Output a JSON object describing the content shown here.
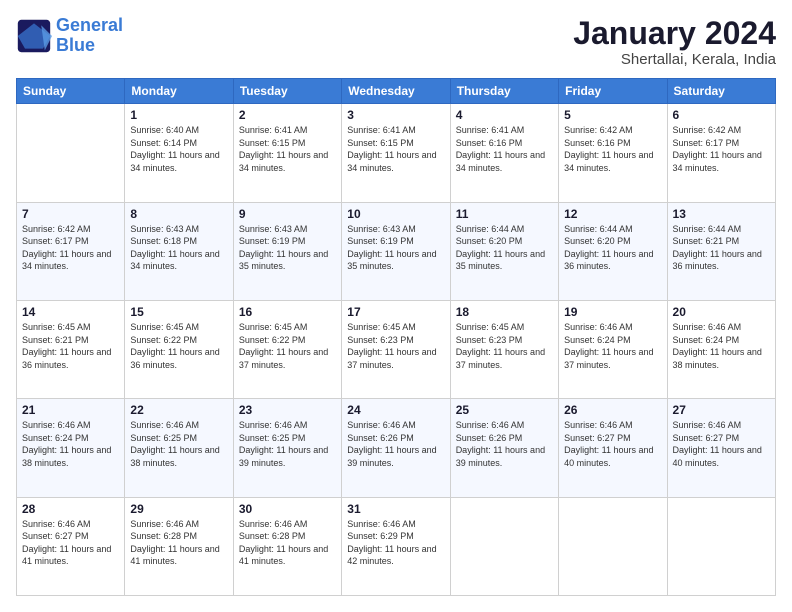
{
  "logo": {
    "line1": "General",
    "line2": "Blue"
  },
  "header": {
    "title": "January 2024",
    "subtitle": "Shertallai, Kerala, India"
  },
  "columns": [
    "Sunday",
    "Monday",
    "Tuesday",
    "Wednesday",
    "Thursday",
    "Friday",
    "Saturday"
  ],
  "weeks": [
    [
      {
        "day": "",
        "sunrise": "",
        "sunset": "",
        "daylight": ""
      },
      {
        "day": "1",
        "sunrise": "Sunrise: 6:40 AM",
        "sunset": "Sunset: 6:14 PM",
        "daylight": "Daylight: 11 hours and 34 minutes."
      },
      {
        "day": "2",
        "sunrise": "Sunrise: 6:41 AM",
        "sunset": "Sunset: 6:15 PM",
        "daylight": "Daylight: 11 hours and 34 minutes."
      },
      {
        "day": "3",
        "sunrise": "Sunrise: 6:41 AM",
        "sunset": "Sunset: 6:15 PM",
        "daylight": "Daylight: 11 hours and 34 minutes."
      },
      {
        "day": "4",
        "sunrise": "Sunrise: 6:41 AM",
        "sunset": "Sunset: 6:16 PM",
        "daylight": "Daylight: 11 hours and 34 minutes."
      },
      {
        "day": "5",
        "sunrise": "Sunrise: 6:42 AM",
        "sunset": "Sunset: 6:16 PM",
        "daylight": "Daylight: 11 hours and 34 minutes."
      },
      {
        "day": "6",
        "sunrise": "Sunrise: 6:42 AM",
        "sunset": "Sunset: 6:17 PM",
        "daylight": "Daylight: 11 hours and 34 minutes."
      }
    ],
    [
      {
        "day": "7",
        "sunrise": "Sunrise: 6:42 AM",
        "sunset": "Sunset: 6:17 PM",
        "daylight": "Daylight: 11 hours and 34 minutes."
      },
      {
        "day": "8",
        "sunrise": "Sunrise: 6:43 AM",
        "sunset": "Sunset: 6:18 PM",
        "daylight": "Daylight: 11 hours and 34 minutes."
      },
      {
        "day": "9",
        "sunrise": "Sunrise: 6:43 AM",
        "sunset": "Sunset: 6:19 PM",
        "daylight": "Daylight: 11 hours and 35 minutes."
      },
      {
        "day": "10",
        "sunrise": "Sunrise: 6:43 AM",
        "sunset": "Sunset: 6:19 PM",
        "daylight": "Daylight: 11 hours and 35 minutes."
      },
      {
        "day": "11",
        "sunrise": "Sunrise: 6:44 AM",
        "sunset": "Sunset: 6:20 PM",
        "daylight": "Daylight: 11 hours and 35 minutes."
      },
      {
        "day": "12",
        "sunrise": "Sunrise: 6:44 AM",
        "sunset": "Sunset: 6:20 PM",
        "daylight": "Daylight: 11 hours and 36 minutes."
      },
      {
        "day": "13",
        "sunrise": "Sunrise: 6:44 AM",
        "sunset": "Sunset: 6:21 PM",
        "daylight": "Daylight: 11 hours and 36 minutes."
      }
    ],
    [
      {
        "day": "14",
        "sunrise": "Sunrise: 6:45 AM",
        "sunset": "Sunset: 6:21 PM",
        "daylight": "Daylight: 11 hours and 36 minutes."
      },
      {
        "day": "15",
        "sunrise": "Sunrise: 6:45 AM",
        "sunset": "Sunset: 6:22 PM",
        "daylight": "Daylight: 11 hours and 36 minutes."
      },
      {
        "day": "16",
        "sunrise": "Sunrise: 6:45 AM",
        "sunset": "Sunset: 6:22 PM",
        "daylight": "Daylight: 11 hours and 37 minutes."
      },
      {
        "day": "17",
        "sunrise": "Sunrise: 6:45 AM",
        "sunset": "Sunset: 6:23 PM",
        "daylight": "Daylight: 11 hours and 37 minutes."
      },
      {
        "day": "18",
        "sunrise": "Sunrise: 6:45 AM",
        "sunset": "Sunset: 6:23 PM",
        "daylight": "Daylight: 11 hours and 37 minutes."
      },
      {
        "day": "19",
        "sunrise": "Sunrise: 6:46 AM",
        "sunset": "Sunset: 6:24 PM",
        "daylight": "Daylight: 11 hours and 37 minutes."
      },
      {
        "day": "20",
        "sunrise": "Sunrise: 6:46 AM",
        "sunset": "Sunset: 6:24 PM",
        "daylight": "Daylight: 11 hours and 38 minutes."
      }
    ],
    [
      {
        "day": "21",
        "sunrise": "Sunrise: 6:46 AM",
        "sunset": "Sunset: 6:24 PM",
        "daylight": "Daylight: 11 hours and 38 minutes."
      },
      {
        "day": "22",
        "sunrise": "Sunrise: 6:46 AM",
        "sunset": "Sunset: 6:25 PM",
        "daylight": "Daylight: 11 hours and 38 minutes."
      },
      {
        "day": "23",
        "sunrise": "Sunrise: 6:46 AM",
        "sunset": "Sunset: 6:25 PM",
        "daylight": "Daylight: 11 hours and 39 minutes."
      },
      {
        "day": "24",
        "sunrise": "Sunrise: 6:46 AM",
        "sunset": "Sunset: 6:26 PM",
        "daylight": "Daylight: 11 hours and 39 minutes."
      },
      {
        "day": "25",
        "sunrise": "Sunrise: 6:46 AM",
        "sunset": "Sunset: 6:26 PM",
        "daylight": "Daylight: 11 hours and 39 minutes."
      },
      {
        "day": "26",
        "sunrise": "Sunrise: 6:46 AM",
        "sunset": "Sunset: 6:27 PM",
        "daylight": "Daylight: 11 hours and 40 minutes."
      },
      {
        "day": "27",
        "sunrise": "Sunrise: 6:46 AM",
        "sunset": "Sunset: 6:27 PM",
        "daylight": "Daylight: 11 hours and 40 minutes."
      }
    ],
    [
      {
        "day": "28",
        "sunrise": "Sunrise: 6:46 AM",
        "sunset": "Sunset: 6:27 PM",
        "daylight": "Daylight: 11 hours and 41 minutes."
      },
      {
        "day": "29",
        "sunrise": "Sunrise: 6:46 AM",
        "sunset": "Sunset: 6:28 PM",
        "daylight": "Daylight: 11 hours and 41 minutes."
      },
      {
        "day": "30",
        "sunrise": "Sunrise: 6:46 AM",
        "sunset": "Sunset: 6:28 PM",
        "daylight": "Daylight: 11 hours and 41 minutes."
      },
      {
        "day": "31",
        "sunrise": "Sunrise: 6:46 AM",
        "sunset": "Sunset: 6:29 PM",
        "daylight": "Daylight: 11 hours and 42 minutes."
      },
      {
        "day": "",
        "sunrise": "",
        "sunset": "",
        "daylight": ""
      },
      {
        "day": "",
        "sunrise": "",
        "sunset": "",
        "daylight": ""
      },
      {
        "day": "",
        "sunrise": "",
        "sunset": "",
        "daylight": ""
      }
    ]
  ]
}
